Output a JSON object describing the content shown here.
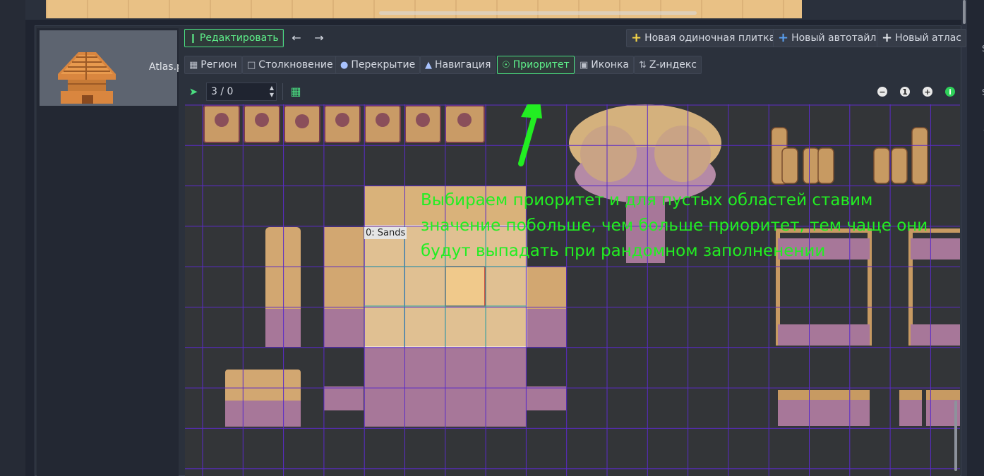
{
  "tile_list": {
    "item_label": "Atlas.png"
  },
  "header_toolbar": {
    "edit_label": "Редактировать",
    "new_single_tile": "Новая одиночная плитка",
    "new_autotile": "Новый автотайл",
    "new_atlas": "Новый атлас"
  },
  "mode_tabs": [
    {
      "label": "Регион",
      "icon": "region-icon"
    },
    {
      "label": "Столкновение",
      "icon": "collision-icon"
    },
    {
      "label": "Перекрытие",
      "icon": "occlusion-icon"
    },
    {
      "label": "Навигация",
      "icon": "navigation-icon"
    },
    {
      "label": "Приоритет",
      "icon": "priority-icon",
      "active": true
    },
    {
      "label": "Иконка",
      "icon": "icon-icon"
    },
    {
      "label": "Z-индекс",
      "icon": "z-index-icon"
    }
  ],
  "sub_toolbar": {
    "spin_value": "3  / 0"
  },
  "canvas": {
    "region_label": "0: Sands",
    "annotation": "Выбираем приоритет и для пустых областей ставим значение побольше, чем больше приоритет, тем чаще они будут выпадать при рандомном заполненении"
  },
  "zoom": {
    "reset_label": "1"
  },
  "colors": {
    "accent": "#4ade80",
    "annotation": "#22ee22",
    "grid": "#5b2bc8",
    "sand": "#d9b27a",
    "rock": "#a77799"
  }
}
